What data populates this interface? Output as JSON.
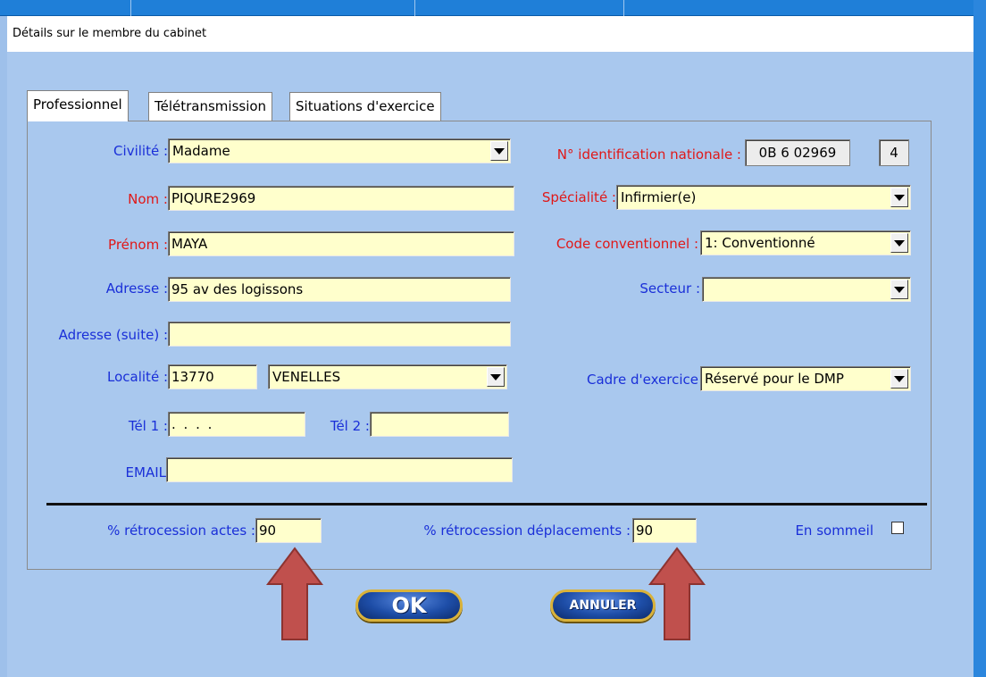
{
  "window": {
    "title": "Détails sur le membre du cabinet"
  },
  "tabs": [
    {
      "label": "Professionnel",
      "active": true
    },
    {
      "label": "Télétransmission",
      "active": false
    },
    {
      "label": "Situations d'exercice",
      "active": false
    }
  ],
  "form": {
    "civilite": {
      "label": "Civilité :",
      "value": "Madame"
    },
    "nom": {
      "label": "Nom :",
      "value": "PIQURE2969"
    },
    "prenom": {
      "label": "Prénom :",
      "value": "MAYA"
    },
    "adresse": {
      "label": "Adresse :",
      "value": "95 av des logissons"
    },
    "adresse_suite": {
      "label": "Adresse (suite) :",
      "value": ""
    },
    "localite": {
      "label": "Localité :",
      "code_postal": "13770",
      "ville": "VENELLES"
    },
    "tel1": {
      "label": "Tél 1 :",
      "value": " . . . ."
    },
    "tel2": {
      "label": "Tél 2 :",
      "value": ""
    },
    "email": {
      "label": "EMAIL",
      "value": ""
    },
    "id_nationale": {
      "label": "N° identification nationale :",
      "value": "0B 6 02969",
      "key": "4"
    },
    "specialite": {
      "label": "Spécialité :",
      "value": "Infirmier(e)"
    },
    "code_conventionnel": {
      "label": "Code conventionnel :",
      "value": "1: Conventionné"
    },
    "secteur": {
      "label": "Secteur :",
      "value": ""
    },
    "cadre_exercice": {
      "label": "Cadre d'exercice",
      "value": "Réservé pour le DMP"
    },
    "retro_actes": {
      "label": "% rétrocession actes :",
      "value": "90"
    },
    "retro_deplacements": {
      "label": "% rétrocession déplacements :",
      "value": "90"
    },
    "en_sommeil": {
      "label": "En sommeil",
      "checked": false
    }
  },
  "buttons": {
    "ok": "OK",
    "annuler": "ANNULER"
  },
  "colors": {
    "label_blue": "#1a2fd8",
    "label_red": "#e01818",
    "field_bg": "#ffffcc",
    "panel_bg": "#a9c8ee",
    "arrow": "#c0504d"
  }
}
